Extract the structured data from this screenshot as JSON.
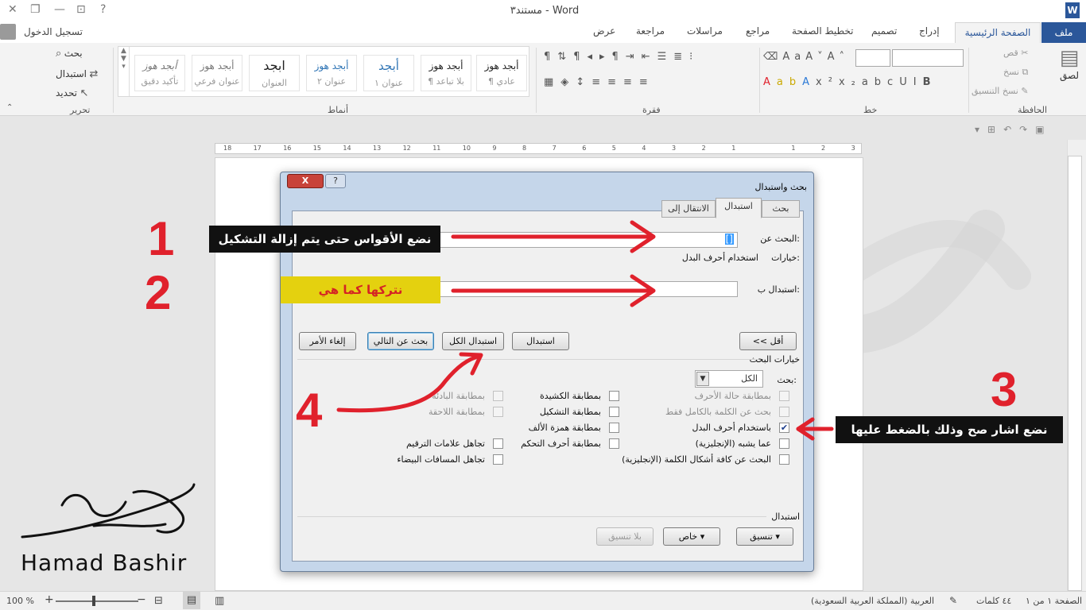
{
  "window": {
    "title": "مستند٣ - Word",
    "signin": "تسجيل الدخول"
  },
  "tabs": [
    "ملف",
    "الصفحة الرئيسية",
    "إدراج",
    "تصميم",
    "تخطيط الصفحة",
    "مراجع",
    "مراسلات",
    "مراجعة",
    "عرض"
  ],
  "ribbon": {
    "clipboard": {
      "label": "الحافظة",
      "paste": "لصق",
      "cut": "قص",
      "copy": "نسخ",
      "format_painter": "نسخ التنسيق"
    },
    "font": {
      "label": "خط"
    },
    "paragraph": {
      "label": "فقرة"
    },
    "styles": {
      "label": "أنماط",
      "items": [
        {
          "preview": "أبجد هوز",
          "name": "¶ عادي"
        },
        {
          "preview": "أبجد هوز",
          "name": "¶ بلا تباعد"
        },
        {
          "preview": "أبجد",
          "name": "عنوان ١"
        },
        {
          "preview": "أبجد هوز",
          "name": "عنوان ٢"
        },
        {
          "preview": "ابجد",
          "name": "العنوان"
        },
        {
          "preview": "أبجد هوز",
          "name": "عنوان فرعي"
        },
        {
          "preview": "أبجد هوز",
          "name": "تأكيد دقيق"
        }
      ]
    },
    "editing": {
      "label": "تحرير",
      "find": "بحث",
      "replace": "استبدال",
      "select": "تحديد"
    }
  },
  "ruler_numbers": [
    "18",
    "17",
    "16",
    "15",
    "14",
    "13",
    "12",
    "11",
    "10",
    "9",
    "8",
    "7",
    "6",
    "5",
    "4",
    "3",
    "2",
    "1",
    "",
    "1",
    "2",
    "3"
  ],
  "dialog": {
    "title": "بحث واستبدال",
    "close": "X",
    "help": "?",
    "tabs": {
      "find": "بحث",
      "replace": "استبدال",
      "goto": "الانتقال إلى"
    },
    "find_label": "البحث عن:",
    "find_value": "[]",
    "options_label": "خيارات:",
    "options_value": "استخدام أحرف البدل",
    "replace_label": "استبدال ب:",
    "replace_value": "",
    "buttons": {
      "less": "<< أقل",
      "replace": "استبدال",
      "replace_all": "استبدال الكل",
      "find_next": "بحث عن التالي",
      "cancel": "إلغاء الأمر"
    },
    "search_options_title": "خيارات البحث",
    "search_label": "بحث:",
    "search_value": "الكل",
    "checks": [
      {
        "label": "بمطابقة حالة الأحرف",
        "checked": false,
        "disabled": true
      },
      {
        "label": "بحث عن الكلمة بالكامل فقط",
        "checked": false,
        "disabled": true
      },
      {
        "label": "باستخدام أحرف البدل",
        "checked": true,
        "disabled": false
      },
      {
        "label": "عما يشبه (الإنجليزية)",
        "checked": false,
        "disabled": false
      },
      {
        "label": "البحث عن كافة أشكال الكلمة (الإنجليزية)",
        "checked": false,
        "disabled": false
      },
      {
        "label": "بمطابقة الكشيدة",
        "checked": false,
        "disabled": false
      },
      {
        "label": "بمطابقة التشكيل",
        "checked": false,
        "disabled": false
      },
      {
        "label": "بمطابقة همزة الألف",
        "checked": false,
        "disabled": false
      },
      {
        "label": "بمطابقة أحرف التحكم",
        "checked": false,
        "disabled": false
      },
      {
        "label": "بمطابقة البادئة",
        "checked": false,
        "disabled": true
      },
      {
        "label": "بمطابقة اللاحقة",
        "checked": false,
        "disabled": true
      },
      {
        "label": "تجاهل علامات الترقيم",
        "checked": false,
        "disabled": false
      },
      {
        "label": "تجاهل المسافات البيضاء",
        "checked": false,
        "disabled": false
      }
    ],
    "replace_section": "استبدال",
    "format": "تنسيق",
    "special": "خاص",
    "no_format": "بلا تنسيق"
  },
  "annotations": {
    "n1": "1",
    "n2": "2",
    "n3": "3",
    "n4": "4",
    "a1": "نضع الأقواس حتى يتم إزالة التشكيل",
    "a2": "نتركها كما هي",
    "a3": "نضع اشار صح وذلك بالضغط عليها"
  },
  "signature": "Hamad Bashir",
  "status": {
    "page": "الصفحة ١ من ١",
    "words": "٤٤ كلمات",
    "language": "العربية (المملكة العربية السعودية)",
    "zoom": "100 %"
  },
  "colors": {
    "accent": "#2b579a",
    "annotation_red": "#e0212c",
    "annotation_yellow": "#e4d10f"
  }
}
